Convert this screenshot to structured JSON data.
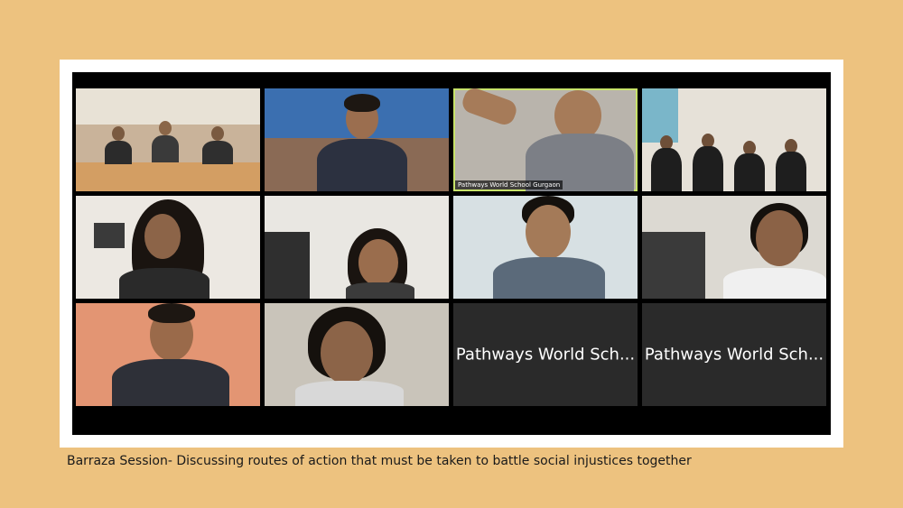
{
  "meeting": {
    "tiles": [
      {
        "id": "t1",
        "label": ""
      },
      {
        "id": "t2",
        "label": ""
      },
      {
        "id": "t3",
        "label": "Pathways World School Gurgaon",
        "active": true
      },
      {
        "id": "t4",
        "label": ""
      },
      {
        "id": "t5",
        "label": ""
      },
      {
        "id": "t6",
        "label": ""
      },
      {
        "id": "t7",
        "label": ""
      },
      {
        "id": "t8",
        "label": ""
      },
      {
        "id": "t9",
        "label": ""
      },
      {
        "id": "t10",
        "label": ""
      },
      {
        "id": "t11",
        "name_placeholder": "Pathways World Sch..."
      },
      {
        "id": "t12",
        "name_placeholder": "Pathways World Sch..."
      }
    ]
  },
  "caption": "Barraza Session- Discussing routes of action that must be taken to battle social injustices together",
  "colors": {
    "page_background": "#EDC27F",
    "frame": "#FFFFFF",
    "meeting_background": "#000000",
    "active_speaker_border": "#C8E36A",
    "camera_off_tile": "#2a2a2a"
  }
}
